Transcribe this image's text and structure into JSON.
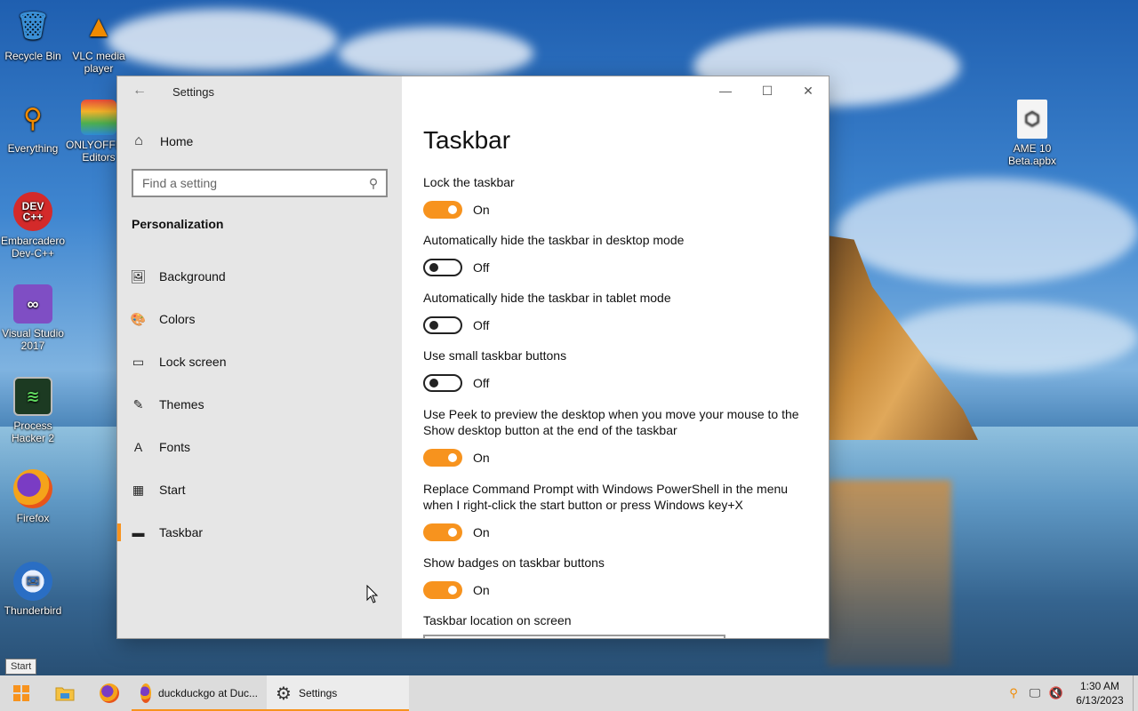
{
  "desktop": {
    "icons": [
      {
        "label": "Recycle Bin",
        "glyph": "🗑",
        "color": "#3a8fd6"
      },
      {
        "label": "VLC media player",
        "glyph": "▲",
        "color": "#f08a00"
      },
      {
        "label": "Everything",
        "glyph": "🔍",
        "color": "#f08a00"
      },
      {
        "label": "ONLYOFFICE Editors",
        "glyph": "◆",
        "color": "#2e8bd6"
      },
      {
        "label": "Embarcadero Dev-C++",
        "glyph": "DEV C++",
        "color": "#d42a2a"
      },
      {
        "label": "Visual Studio 2017",
        "glyph": "◁▷",
        "color": "#7f4ec4"
      },
      {
        "label": "Process Hacker 2",
        "glyph": "▦",
        "color": "#2f7a3a"
      },
      {
        "label": "Firefox",
        "glyph": "◉",
        "color": "#e86a1a"
      },
      {
        "label": "Thunderbird",
        "glyph": "✉",
        "color": "#2a6ec4"
      },
      {
        "label": "AME 10 Beta.apbx",
        "glyph": "⬡",
        "color": "#e8e8e8"
      }
    ]
  },
  "window": {
    "title": "Settings",
    "back_icon": "←",
    "controls": {
      "minimize": "—",
      "maximize": "☐",
      "close": "✕"
    }
  },
  "sidebar": {
    "home": {
      "label": "Home",
      "icon": "⌂"
    },
    "search": {
      "placeholder": "Find a setting",
      "icon": "⚲"
    },
    "section": "Personalization",
    "items": [
      {
        "label": "Background",
        "icon": "🖼"
      },
      {
        "label": "Colors",
        "icon": "🎨"
      },
      {
        "label": "Lock screen",
        "icon": "▭"
      },
      {
        "label": "Themes",
        "icon": "✎"
      },
      {
        "label": "Fonts",
        "icon": "A"
      },
      {
        "label": "Start",
        "icon": "▦"
      },
      {
        "label": "Taskbar",
        "icon": "▬"
      }
    ],
    "active_item": "Taskbar"
  },
  "content": {
    "title": "Taskbar",
    "settings": [
      {
        "label": "Lock the taskbar",
        "state": "On"
      },
      {
        "label": "Automatically hide the taskbar in desktop mode",
        "state": "Off"
      },
      {
        "label": "Automatically hide the taskbar in tablet mode",
        "state": "Off"
      },
      {
        "label": "Use small taskbar buttons",
        "state": "Off"
      },
      {
        "label": "Use Peek to preview the desktop when you move your mouse to the Show desktop button at the end of the taskbar",
        "state": "On"
      },
      {
        "label": "Replace Command Prompt with Windows PowerShell in the menu when I right-click the start button or press Windows key+X",
        "state": "On"
      },
      {
        "label": "Show badges on taskbar buttons",
        "state": "On"
      }
    ],
    "next_section_label": "Taskbar location on screen"
  },
  "taskbar": {
    "start_tooltip": "Start",
    "apps": [
      {
        "label": "duckduckgo at Duc...",
        "icon": "firefox-icon"
      },
      {
        "label": "Settings",
        "icon": "gear-icon"
      }
    ],
    "clock": {
      "time": "1:30 AM",
      "date": "6/13/2023"
    }
  },
  "colors": {
    "accent": "#f7931e"
  }
}
